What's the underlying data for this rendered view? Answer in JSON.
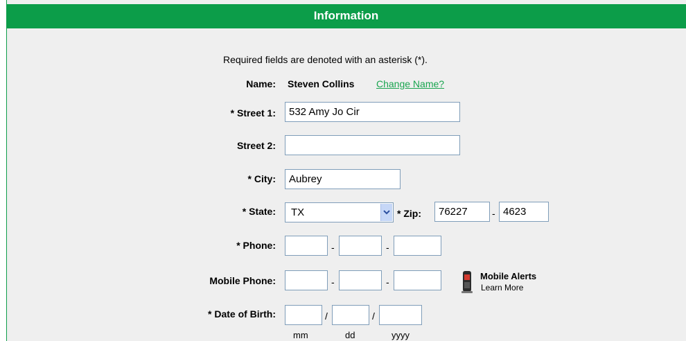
{
  "header": {
    "title": "Information"
  },
  "notice": "Required fields are denoted with an asterisk (*).",
  "name": {
    "label": "Name:",
    "value": "Steven Collins",
    "change_link": "Change Name?"
  },
  "street1": {
    "label": "* Street 1:",
    "value": "532 Amy Jo Cir"
  },
  "street2": {
    "label": "Street 2:",
    "value": ""
  },
  "city": {
    "label": "* City:",
    "value": "Aubrey"
  },
  "state": {
    "label": "* State:",
    "value": "TX"
  },
  "zip": {
    "label": "* Zip:",
    "value": "76227",
    "ext": "4623",
    "dash": "-"
  },
  "phone": {
    "label": "* Phone:",
    "area": "",
    "prefix": "",
    "line": "",
    "dash": "-"
  },
  "mobile": {
    "label": "Mobile Phone:",
    "area": "",
    "prefix": "",
    "line": "",
    "dash": "-"
  },
  "mobile_alerts": {
    "title": "Mobile Alerts",
    "link": "Learn More",
    "icon": "mobile-phone-icon"
  },
  "dob": {
    "label": "* Date of Birth:",
    "mm": "",
    "dd": "",
    "yyyy": "",
    "sep": "/",
    "hint_mm": "mm",
    "hint_dd": "dd",
    "hint_yyyy": "yyyy"
  },
  "colors": {
    "header_green": "#0c9d49",
    "link_green": "#1aa550",
    "panel_bg": "#efefef"
  }
}
